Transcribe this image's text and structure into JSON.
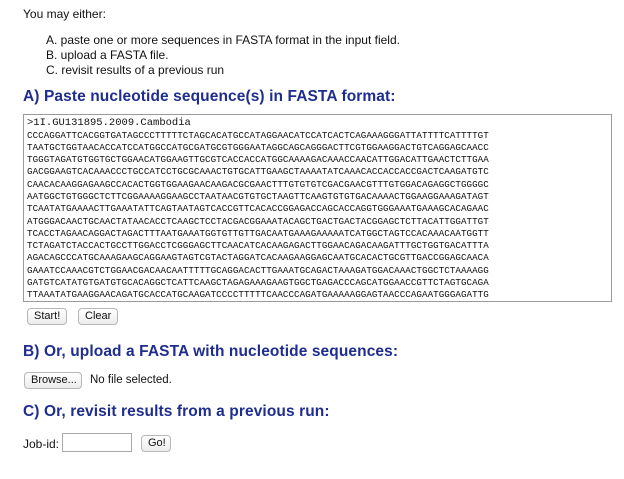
{
  "intro": {
    "text": "You may either:",
    "options": [
      "A. paste one or more sequences in FASTA format in the input field.",
      "B. upload a FASTA file.",
      "C. revisit results of a previous run"
    ]
  },
  "section_a": {
    "title": "A) Paste nucleotide sequence(s) in FASTA format:",
    "header_line": ">1I.GU131895.2009.Cambodia",
    "sequence_lines": [
      "CCCAGGATTCACGGTGATAGCCCTTTTTCTAGCACATGCCATAGGAACATCCATCACTCAGAAAGGGATTATTTTCATTTTGT",
      "TAATGCTGGTAACACCATCCATGGCCATGCGATGCGTGGGAATAGGCAGCAGGGACTTCGTGGAAGGACTGTCAGGAGCAACC",
      "TGGGTAGATGTGGTGCTGGAACATGGAAGTTGCGTCACCACCATGGCAAAAGACAAACCAACATTGGACATTGAACTCTTGAA",
      "GACGGAAGTCACAAACCCTGCCATCCTGCGCAAACTGTGCATTGAAGCTAAAATATCAAACACCACCACCGACTCAAGATGTC",
      "CAACACAAGGAGAAGCCACACTGGTGGAAGAACAAGACGCGAACTTTGTGTGTCGACGAACGTTTGTGGACAGAGGCTGGGGC",
      "AATGGCTGTGGGCTCTTCGGAAAAGGAAGCCTAATAACGTGTGCTAAGTTCAAGTGTGTGACAAAACTGGAAGGAAAGATAGT",
      "TCAATATGAAAACTTGAAATATTCAGTAATAGTCACCGTTCACACCGGAGACCAGCACCAGGTGGGAAATGAAAGCACAGAAC",
      "ATGGGACAACTGCAACTATAACACCTCAAGCTCCTACGACGGAAATACAGCTGACTGACTACGGAGCTCTTACATTGGATTGT",
      "TCACCTAGAACAGGACTAGACTTTAATGAAATGGTGTTGTTGACAATGAAAGAAAAATCATGGCTAGTCCACAAACAATGGTT",
      "TCTAGATCTACCACTGCCTTGGACCTCGGGAGCTTCAACATCACAAGAGACTTGGAACAGACAAGATTTGCTGGTGACATTTA",
      "AGACAGCCCATGCAAAGAAGCAGGAAGTAGTCGTACTAGGATCACAAGAAGGAGCAATGCACACTGCGTTGACCGGAGCAACA",
      "GAAATCCAAACGTCTGGAACGACAACAATTTTTGCAGGACACTTGAAATGCAGACTAAAGATGGACAAACTGGCTCTAAAAGG",
      "GATGTCATATGTGATGTGCACAGGCTCATTCAAGCTAGAGAAAGAAGTGGCTGAGACCCAGCATGGAACCGTTCTAGTGCAGA",
      "TTAAATATGAAGGAACAGATGCACCATGCAAGATCCCCTTTTTCAACCCAGATGAAAAAGGAGTAACCCAGAATGGGAGATTG"
    ],
    "start_label": "Start!",
    "clear_label": "Clear"
  },
  "section_b": {
    "title": "B) Or, upload a FASTA with nucleotide sequences:",
    "browse_label": "Browse...",
    "file_status": "No file selected."
  },
  "section_c": {
    "title": "C) Or, revisit results from a previous run:",
    "job_label": "Job-id:",
    "job_value": "",
    "go_label": "Go!"
  },
  "colors": {
    "section_title": "#1f2d8f"
  }
}
